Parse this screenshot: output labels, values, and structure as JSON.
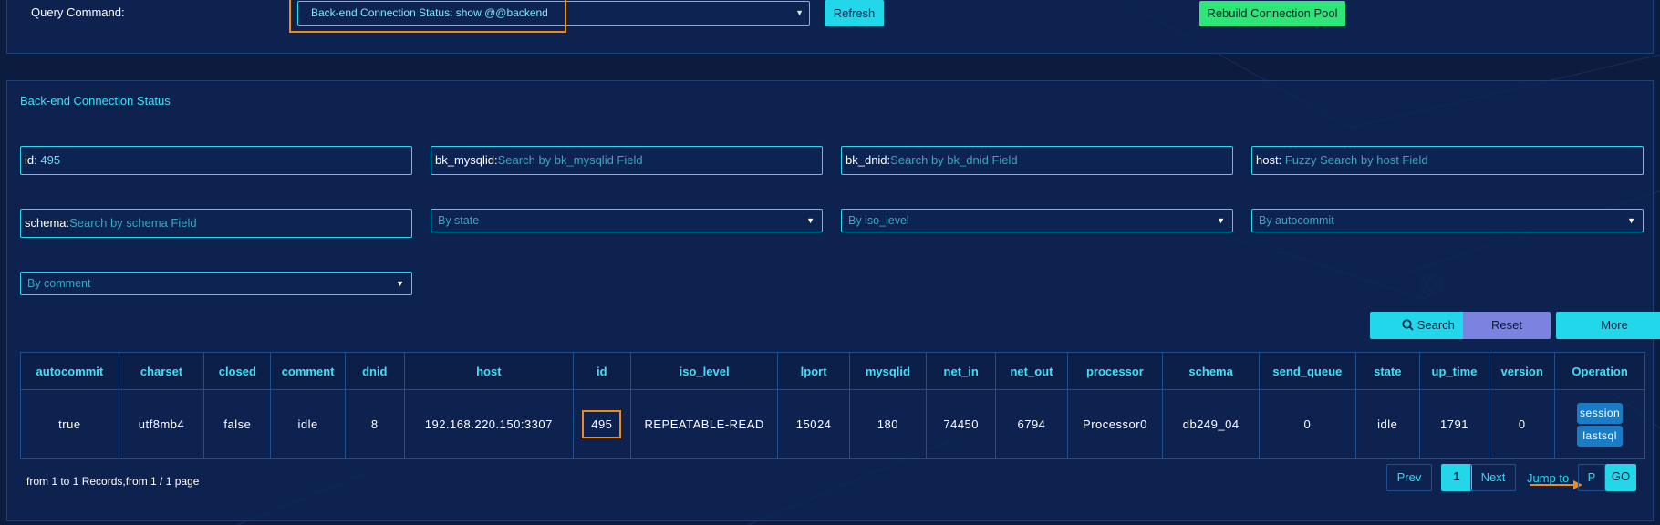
{
  "query": {
    "label": "Query Command:",
    "selected_command": "Back-end Connection Status:  show @@backend",
    "refresh_label": "Refresh",
    "rebuild_label": "Rebuild Connection Pool"
  },
  "panel": {
    "title": "Back-end Connection Status"
  },
  "filters": {
    "id": {
      "label": "id:",
      "value": "495"
    },
    "bk_mysqlid": {
      "label": "bk_mysqlid:",
      "placeholder": "Search by bk_mysqlid Field"
    },
    "bk_dnid": {
      "label": "bk_dnid:",
      "placeholder": "Search by bk_dnid Field"
    },
    "host": {
      "label": "host:",
      "placeholder": "Fuzzy Search by host Field"
    },
    "schema": {
      "label": "schema:",
      "placeholder": "Search by schema Field"
    },
    "state": "By state",
    "iso_level": "By iso_level",
    "autocommit": "By autocommit",
    "comment": "By comment"
  },
  "actions": {
    "search": "Search",
    "reset": "Reset",
    "more": "More"
  },
  "table": {
    "headers": [
      "autocommit",
      "charset",
      "closed",
      "comment",
      "dnid",
      "host",
      "id",
      "iso_level",
      "lport",
      "mysqlid",
      "net_in",
      "net_out",
      "processor",
      "schema",
      "send_queue",
      "state",
      "up_time",
      "version",
      "Operation"
    ],
    "row": {
      "autocommit": "true",
      "charset": "utf8mb4",
      "closed": "false",
      "comment": "idle",
      "dnid": "8",
      "host": "192.168.220.150:3307",
      "id": "495",
      "iso_level": "REPEATABLE-READ",
      "lport": "15024",
      "mysqlid": "180",
      "net_in": "74450",
      "net_out": "6794",
      "processor": "Processor0",
      "schema": "db249_04",
      "send_queue": "0",
      "state": "idle",
      "up_time": "1791",
      "version": "0",
      "op_session": "session",
      "op_lastsql": "lastsql"
    }
  },
  "pagination": {
    "records_text": "from 1 to 1 Records,from 1 / 1 page",
    "prev": "Prev",
    "current": "1",
    "next": "Next",
    "jump_label": "Jump to",
    "page_placeholder": "P",
    "go": "GO"
  },
  "colors": {
    "background": "#0b1c3e",
    "accent_cyan": "#22d7ea",
    "highlight_orange": "#f18a1c",
    "rebuild_green": "#2ee577",
    "reset_purple": "#7b82e0"
  },
  "icons": {
    "search": "search-icon",
    "select_arrow": "caret-down-icon"
  }
}
